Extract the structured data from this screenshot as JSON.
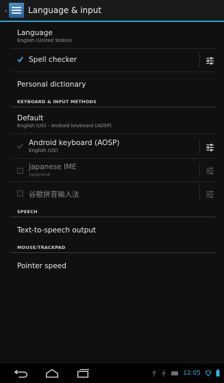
{
  "actionbar": {
    "title": "Language & input",
    "up_caret": "‹"
  },
  "language": {
    "title": "Language",
    "summary": "English (United States)"
  },
  "spell_checker": {
    "title": "Spell checker",
    "checked": true
  },
  "personal_dictionary": {
    "title": "Personal dictionary"
  },
  "keyboard_header": "KEYBOARD & INPUT METHODS",
  "default": {
    "title": "Default",
    "summary": "English (US) - Android keyboard (AOSP)"
  },
  "input_methods": [
    {
      "title": "Android keyboard (AOSP)",
      "summary": "English (US)",
      "checked": true,
      "enabled": true
    },
    {
      "title": "Japanese IME",
      "summary": "Japanese",
      "checked": false,
      "enabled": false
    },
    {
      "title": "谷歌拼音输入法",
      "summary": "",
      "checked": false,
      "enabled": false
    }
  ],
  "speech_header": "SPEECH",
  "tts": {
    "title": "Text-to-speech output"
  },
  "mouse_header": "MOUSE/TRACKPAD",
  "pointer": {
    "title": "Pointer speed"
  },
  "status": {
    "time": "12:05"
  },
  "colors": {
    "accent": "#33b5e5",
    "bar_line": "#2f9fd3"
  }
}
